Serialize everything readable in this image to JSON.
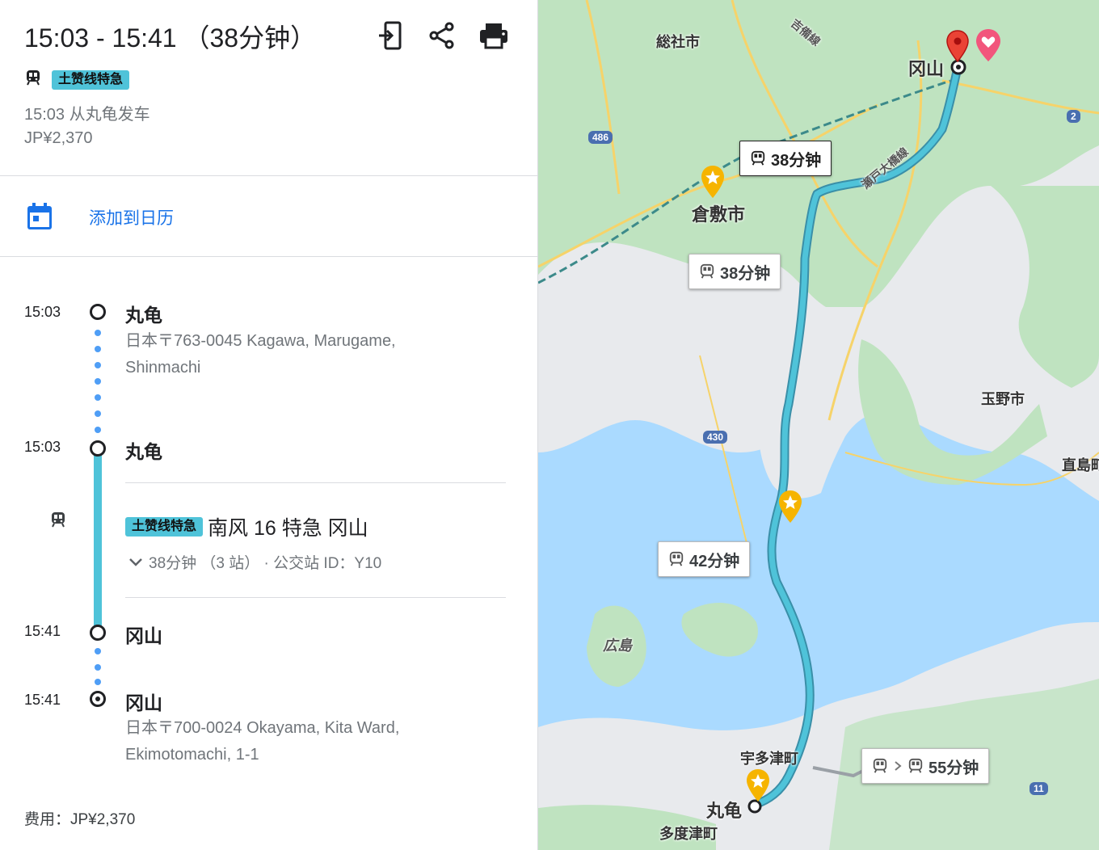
{
  "header": {
    "time_range": "15:03 - 15:41 （38分钟）",
    "icons": [
      "send-to-phone-icon",
      "share-icon",
      "print-icon"
    ]
  },
  "summary": {
    "line_badge": "土赞线特急",
    "depart": "15:03 从丸龟发车",
    "fare": "JP¥2,370"
  },
  "calendar": {
    "label": "添加到日历"
  },
  "steps": {
    "s1": {
      "time": "15:03",
      "name": "丸龟",
      "addr1": "日本〒763-0045 Kagawa, Marugame,",
      "addr2": "Shinmachi"
    },
    "s2": {
      "time": "15:03",
      "name": "丸龟"
    },
    "ride": {
      "badge": "土赞线特急",
      "route": "南风 16 特急 冈山",
      "detail": "38分钟 （3 站） · 公交站 ID：Y10"
    },
    "s3": {
      "time": "15:41",
      "name": "冈山"
    },
    "s4": {
      "time": "15:41",
      "name": "冈山",
      "addr1": "日本〒700-0024 Okayama, Kita Ward,",
      "addr2": "Ekimotomachi, 1-1"
    }
  },
  "cost": "费用：JP¥2,370",
  "map": {
    "places": {
      "soja": "総社市",
      "okayama": "冈山",
      "kurashiki": "倉敷市",
      "tamano": "玉野市",
      "naoshima": "直島町",
      "hiroshima": "広島",
      "utazu": "宇多津町",
      "marugame": "丸龟",
      "tadotsu": "多度津町",
      "kibi": "吉備線",
      "bridge": "瀬戸大橋線"
    },
    "route_boxes": {
      "b1": "38分钟",
      "b2": "38分钟",
      "b3": "42分钟",
      "b4": "55分钟"
    },
    "shields": {
      "r486": "486",
      "r430": "430",
      "r2": "2",
      "r11": "11"
    },
    "colors": {
      "water": "#aadaff",
      "land": "#e8eaed",
      "green": "#bfe3c0",
      "route": "#4fc3d9",
      "accent": "#1a73e8"
    }
  }
}
